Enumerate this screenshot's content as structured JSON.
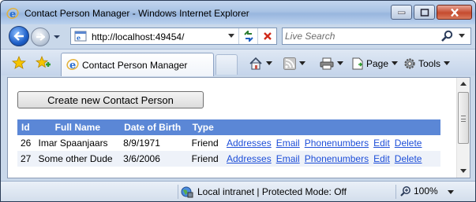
{
  "window": {
    "title": "Contact Person Manager - Windows Internet Explorer"
  },
  "nav": {
    "address": "http://localhost:49454/",
    "search_placeholder": "Live Search"
  },
  "tab": {
    "label": "Contact Person Manager"
  },
  "commands": {
    "page": "Page",
    "tools": "Tools"
  },
  "content": {
    "create_button": "Create new Contact Person",
    "columns": [
      "Id",
      "Full Name",
      "Date of Birth",
      "Type"
    ],
    "rows": [
      {
        "id": "26",
        "full_name": "Imar Spaanjaars",
        "date_of_birth": "8/9/1971",
        "type": "Friend",
        "links": [
          "Addresses",
          "Email",
          "Phonenumbers",
          "Edit",
          "Delete"
        ]
      },
      {
        "id": "27",
        "full_name": "Some other Dude",
        "date_of_birth": "3/6/2006",
        "type": "Friend",
        "links": [
          "Addresses",
          "Email",
          "Phonenumbers",
          "Edit",
          "Delete"
        ]
      }
    ]
  },
  "status": {
    "zone": "Local intranet | Protected Mode: Off",
    "zoom": "100%"
  },
  "colors": {
    "header_bg": "#5b87d6",
    "link": "#1d4ed8"
  }
}
